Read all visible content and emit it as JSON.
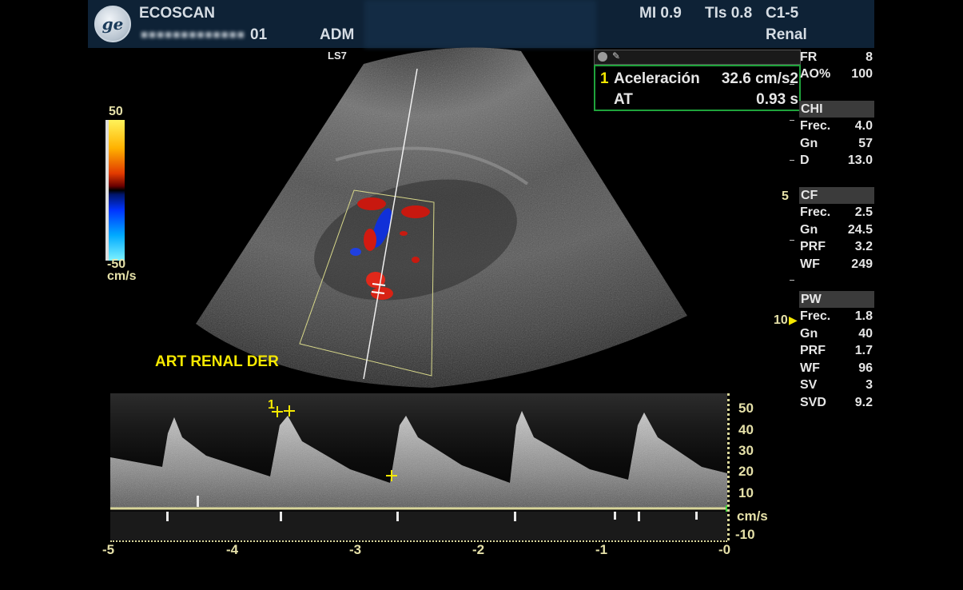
{
  "header": {
    "brand": "ECOSCAN",
    "patient_id": "01",
    "operator": "ADM",
    "mi": "MI 0.9",
    "tis": "TIs 0.8",
    "probe": "C1-5",
    "preset": "Renal"
  },
  "image_label": "LS7",
  "annotation": "ART RENAL DER",
  "colorbar": {
    "max": "50",
    "min": "-50",
    "unit": "cm/s"
  },
  "measurement": {
    "index": "1",
    "row1_label": "Aceleración",
    "row1_value": "32.6 cm/s2",
    "row2_label": "AT",
    "row2_value": "0.93 s"
  },
  "params": {
    "fr_label": "FR",
    "fr_value": "8",
    "ao_label": "AO%",
    "ao_value": "100",
    "chi": {
      "title": "CHI",
      "rows": [
        {
          "label": "Frec.",
          "value": "4.0"
        },
        {
          "label": "Gn",
          "value": "57"
        },
        {
          "label": "D",
          "value": "13.0"
        }
      ]
    },
    "cf": {
      "title": "CF",
      "rows": [
        {
          "label": "Frec.",
          "value": "2.5"
        },
        {
          "label": "Gn",
          "value": "24.5"
        },
        {
          "label": "PRF",
          "value": "3.2"
        },
        {
          "label": "WF",
          "value": "249"
        }
      ]
    },
    "pw": {
      "title": "PW",
      "rows": [
        {
          "label": "Frec.",
          "value": "1.8"
        },
        {
          "label": "Gn",
          "value": "40"
        },
        {
          "label": "PRF",
          "value": "1.7"
        },
        {
          "label": "WF",
          "value": "96"
        },
        {
          "label": "SV",
          "value": "3"
        },
        {
          "label": "SVD",
          "value": "9.2"
        }
      ]
    }
  },
  "depth_markers": {
    "d5": "5",
    "d10": "10"
  },
  "spectral": {
    "y_ticks": [
      "50",
      "40",
      "30",
      "20",
      "10",
      "-10"
    ],
    "y_unit": "cm/s",
    "x_ticks": [
      "-5",
      "-4",
      "-3",
      "-2",
      "-1",
      "-0"
    ],
    "cursor_label": "1"
  },
  "colors": {
    "header_bg": "#0e2236",
    "accent_yellow": "#f5e800",
    "tick_tan": "#e5e0a8",
    "box_green": "#1fa33b"
  }
}
